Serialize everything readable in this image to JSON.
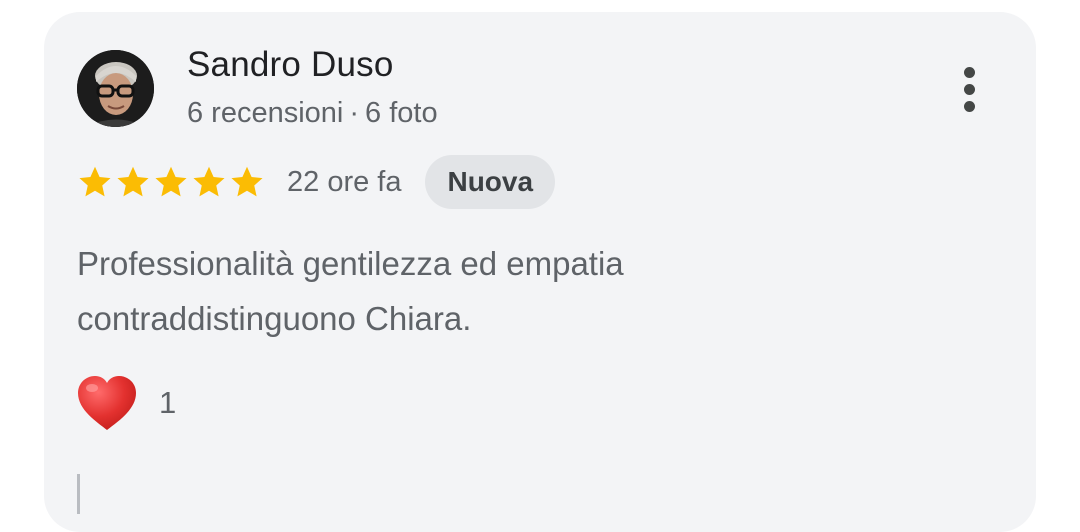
{
  "review": {
    "author": {
      "name": "Sandro Duso",
      "reviews_count": "6 recensioni",
      "separator": "·",
      "photos_count": "6 foto"
    },
    "rating": {
      "stars": 5,
      "max_stars": 5,
      "star_color": "#fbbc04"
    },
    "time_ago": "22 ore fa",
    "badge": "Nuova",
    "text_line_1": "Professionalità gentilezza ed empatia",
    "text_line_2": "contraddistinguono Chiara.",
    "reaction": {
      "icon": "heart-icon",
      "color": "#e3312f",
      "count": "1"
    }
  }
}
